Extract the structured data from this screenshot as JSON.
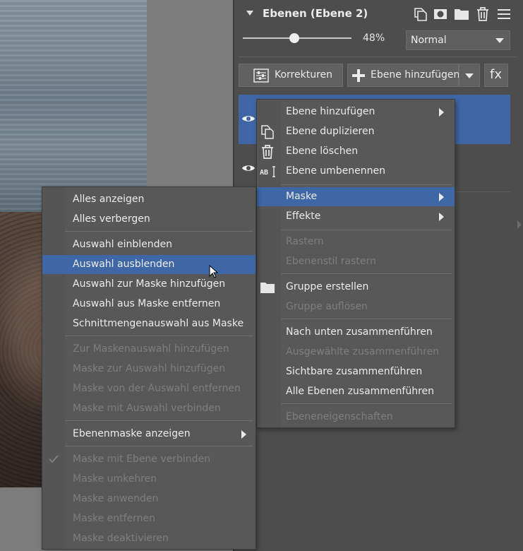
{
  "layers_panel": {
    "title": "Ebenen (Ebene 2)",
    "opacity": {
      "label": "48%",
      "value": 0.48
    },
    "blend_mode": "Normal",
    "buttons": {
      "korrekturen": "Korrekturen",
      "add_layer": "Ebene hinzufügen",
      "fx": "fx"
    },
    "header_icons": [
      "duplicate-icon",
      "mask-icon",
      "folder-icon",
      "trash-icon",
      "menu-icon"
    ]
  },
  "layer_context_menu": {
    "items": [
      {
        "label": "Ebene hinzufügen",
        "enabled": true,
        "submenu": true
      },
      {
        "label": "Ebene duplizieren",
        "enabled": true,
        "icon": "duplicate-icon"
      },
      {
        "label": "Ebene löschen",
        "enabled": true,
        "icon": "trash-icon"
      },
      {
        "label": "Ebene umbenennen",
        "enabled": true,
        "icon": "rename-icon"
      },
      {
        "label": "Maske",
        "enabled": true,
        "submenu": true,
        "highlighted": true
      },
      {
        "label": "Effekte",
        "enabled": true,
        "submenu": true
      },
      {
        "label": "Rastern",
        "enabled": false
      },
      {
        "label": "Ebenenstil rastern",
        "enabled": false
      },
      {
        "label": "Gruppe erstellen",
        "enabled": true,
        "icon": "folder-icon"
      },
      {
        "label": "Gruppe auflösen",
        "enabled": false
      },
      {
        "label": "Nach unten zusammenführen",
        "enabled": true
      },
      {
        "label": "Ausgewählte zusammenführen",
        "enabled": false
      },
      {
        "label": "Sichtbare zusammenführen",
        "enabled": true
      },
      {
        "label": "Alle Ebenen zusammenführen",
        "enabled": true
      },
      {
        "label": "Ebeneneigenschaften",
        "enabled": false
      }
    ]
  },
  "mask_submenu": {
    "items": [
      {
        "label": "Alles anzeigen",
        "enabled": true
      },
      {
        "label": "Alles verbergen",
        "enabled": true
      },
      {
        "label": "Auswahl einblenden",
        "enabled": true
      },
      {
        "label": "Auswahl ausblenden",
        "enabled": true,
        "highlighted": true
      },
      {
        "label": "Auswahl zur Maske hinzufügen",
        "enabled": true
      },
      {
        "label": "Auswahl aus Maske entfernen",
        "enabled": true
      },
      {
        "label": "Schnittmengenauswahl aus Maske",
        "enabled": true
      },
      {
        "label": "Zur Maskenauswahl hinzufügen",
        "enabled": false
      },
      {
        "label": "Maske zur Auswahl hinzufügen",
        "enabled": false
      },
      {
        "label": "Maske von der Auswahl entfernen",
        "enabled": false
      },
      {
        "label": "Maske mit Auswahl verbinden",
        "enabled": false
      },
      {
        "label": "Ebenenmaske anzeigen",
        "enabled": true,
        "submenu": true
      },
      {
        "label": "Maske mit Ebene verbinden",
        "enabled": false,
        "checked": true
      },
      {
        "label": "Maske umkehren",
        "enabled": false
      },
      {
        "label": "Maske anwenden",
        "enabled": false
      },
      {
        "label": "Maske entfernen",
        "enabled": false
      },
      {
        "label": "Maske deaktivieren",
        "enabled": false
      }
    ]
  },
  "colors": {
    "highlight": "#3f66a5",
    "panel_bg": "#4d4d4d",
    "menu_bg": "#585858",
    "disabled_text": "#7d7d7d"
  }
}
